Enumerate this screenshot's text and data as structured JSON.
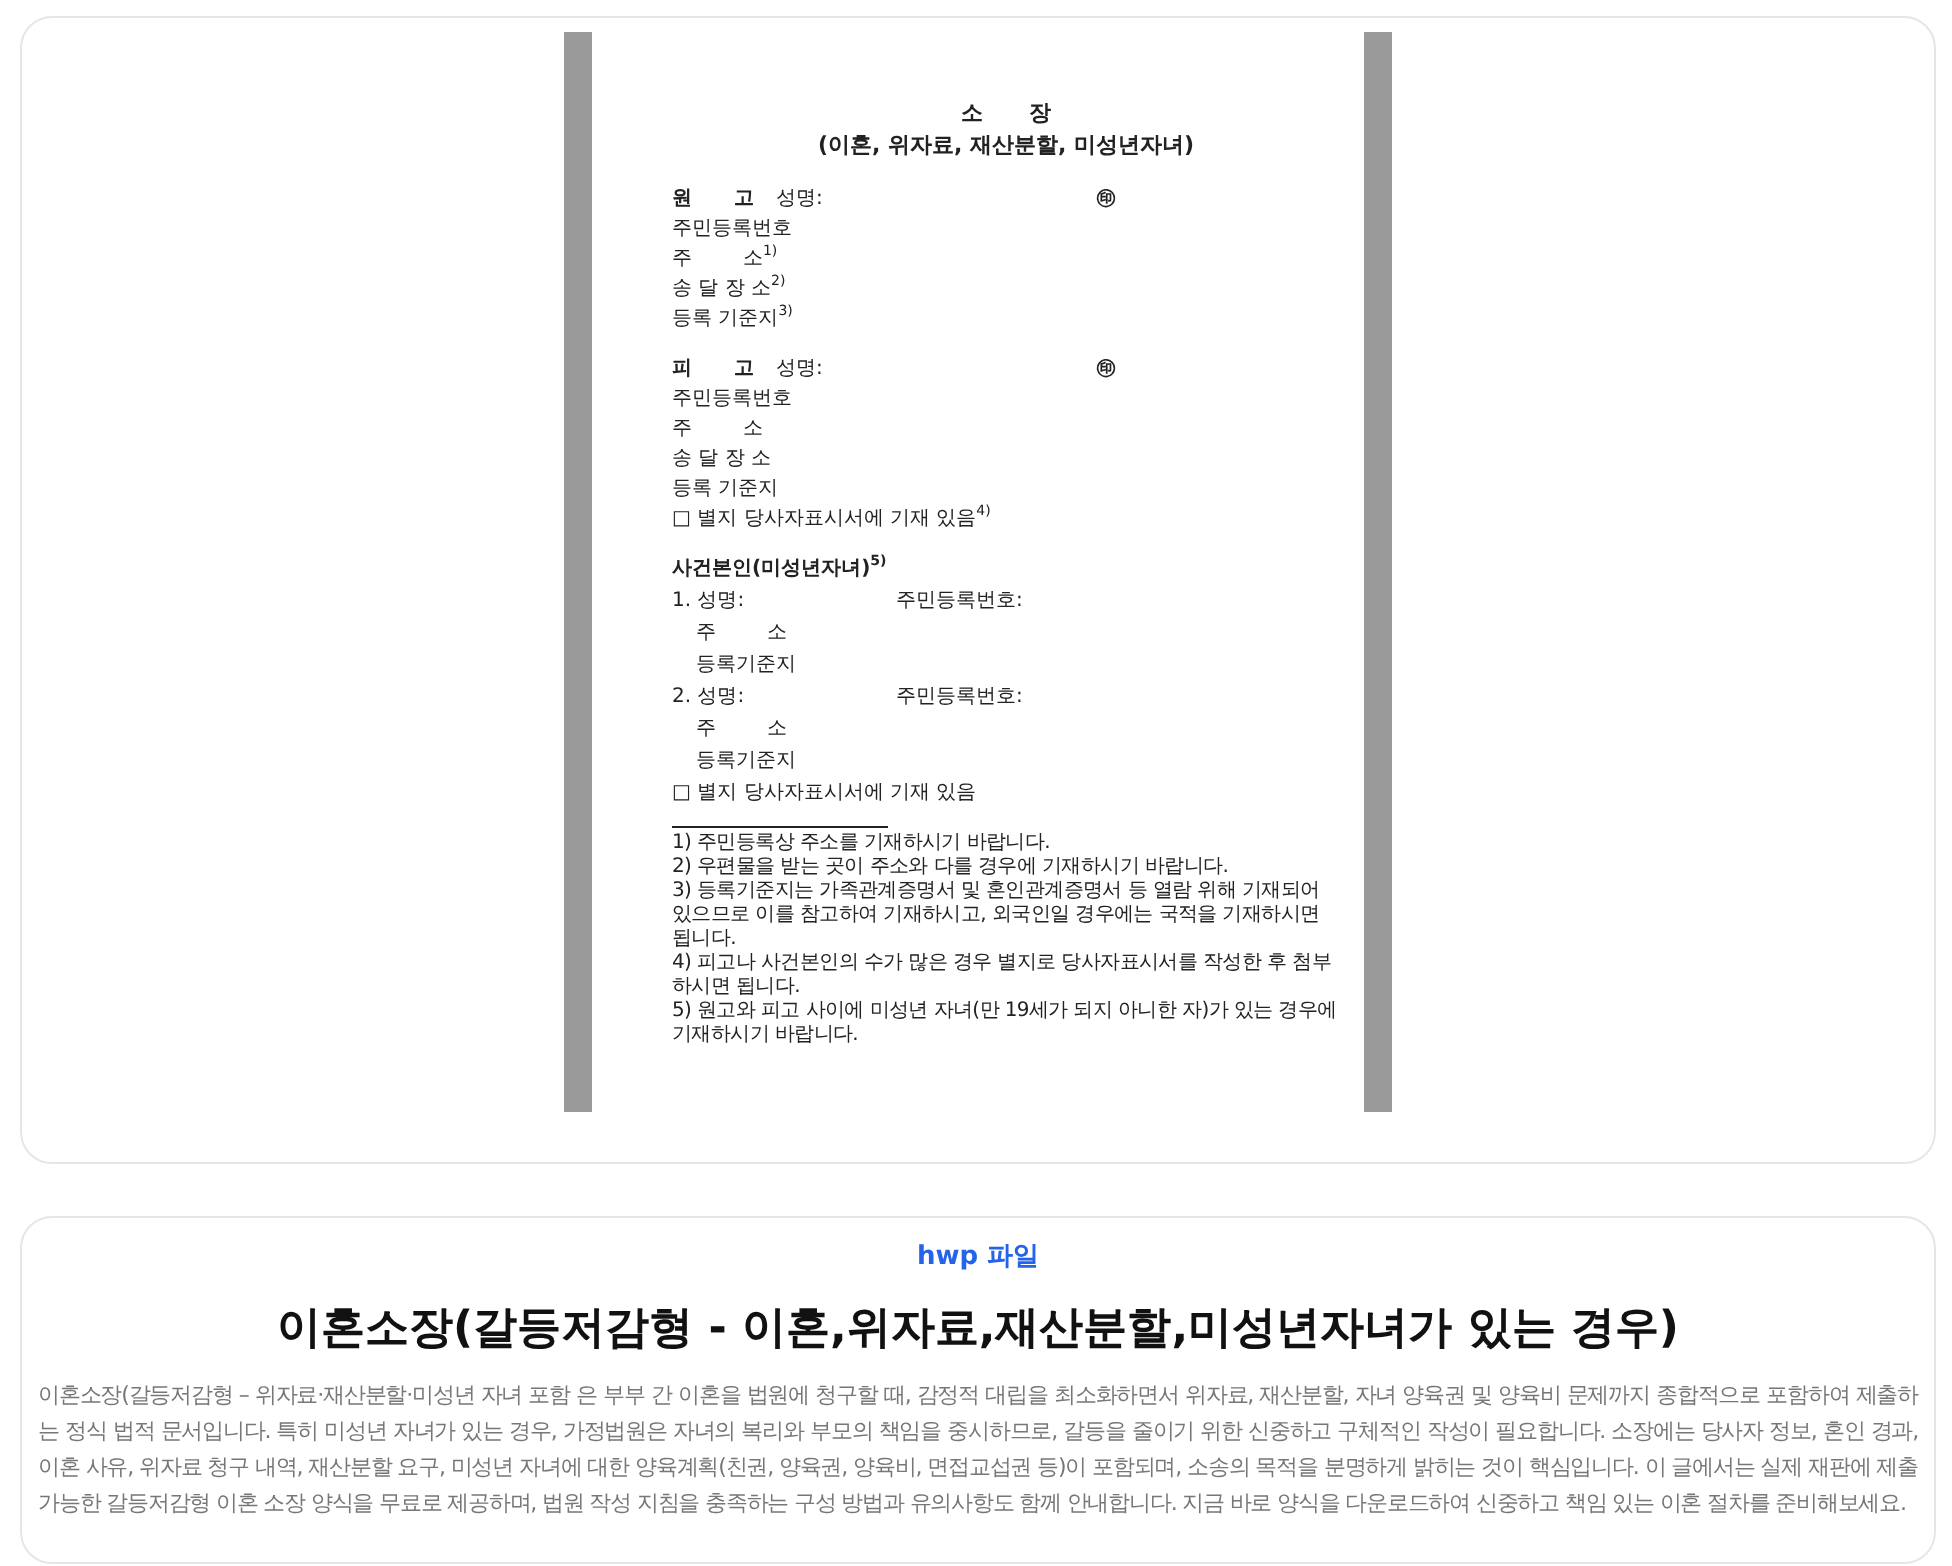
{
  "document": {
    "title": "소      장",
    "subtitle": "(이혼, 위자료, 재산분할, 미성년자녀)",
    "parties": [
      {
        "role": "원      고",
        "name_label": "성명:",
        "seal": "㊞",
        "rows": [
          "주민등록번호",
          "주        소$^{1)}$",
          "송 달 장 소$^{2)}$",
          "등록 기준지$^{3)}$"
        ]
      },
      {
        "role": "피      고",
        "name_label": "성명:",
        "seal": "㊞",
        "rows": [
          "주민등록번호",
          "주        소",
          "송 달 장 소",
          "등록 기준지"
        ],
        "note": "□ 별지 당사자표시서에 기재 있음$^{4)}$"
      }
    ],
    "children": {
      "heading": "사건본인(미성년자녀)$^{5)}$",
      "items": [
        {
          "name_label": "1. 성명:",
          "id_label": "주민등록번호:",
          "rows": [
            "주        소",
            "등록기준지"
          ]
        },
        {
          "name_label": "2. 성명:",
          "id_label": "주민등록번호:",
          "rows": [
            "주        소",
            "등록기준지"
          ]
        }
      ],
      "note": "□ 별지 당사자표시서에 기재 있음"
    },
    "footnotes": [
      "1) 주민등록상 주소를 기재하시기 바랍니다.",
      "2) 우편물을 받는 곳이 주소와 다를 경우에 기재하시기 바랍니다.",
      "3) 등록기준지는 가족관계증명서 및 혼인관계증명서 등 열람 위해 기재되어 있으므로 이를 참고하여 기재하시고, 외국인일 경우에는 국적을 기재하시면 됩니다.",
      "4) 피고나 사건본인의 수가 많은 경우 별지로 당사자표시서를 작성한 후 첨부하시면 됩니다.",
      "5) 원고와 피고 사이에 미성년 자녀(만 19세가 되지 아니한 자)가 있는 경우에 기재하시기 바랍니다."
    ]
  },
  "file_type": "hwp 파일",
  "title": "이혼소장(갈등저감형 - 이혼,위자료,재산분할,미성년자녀가 있는 경우)",
  "description": "이혼소장(갈등저감형 – 위자료·재산분할·미성년 자녀 포함 은 부부 간 이혼을 법원에 청구할 때, 감정적 대립을 최소화하면서 위자료, 재산분할, 자녀 양육권 및 양육비 문제까지 종합적으로 포함하여 제출하는 정식 법적 문서입니다. 특히 미성년 자녀가 있는 경우, 가정법원은 자녀의 복리와 부모의 책임을 중시하므로, 갈등을 줄이기 위한 신중하고 구체적인 작성이 필요합니다. 소장에는 당사자 정보, 혼인 경과, 이혼 사유, 위자료 청구 내역, 재산분할 요구, 미성년 자녀에 대한 양육계획(친권, 양육권, 양육비, 면접교섭권 등)이 포함되며, 소송의 목적을 분명하게 밝히는 것이 핵심입니다. 이 글에서는 실제 재판에 제출 가능한 갈등저감형 이혼 소장 양식을 무료로 제공하며, 법원 작성 지침을 충족하는 구성 방법과 유의사항도 함께 안내합니다. 지금 바로 양식을 다운로드하여 신중하고 책임 있는 이혼 절차를 준비해보세요."
}
